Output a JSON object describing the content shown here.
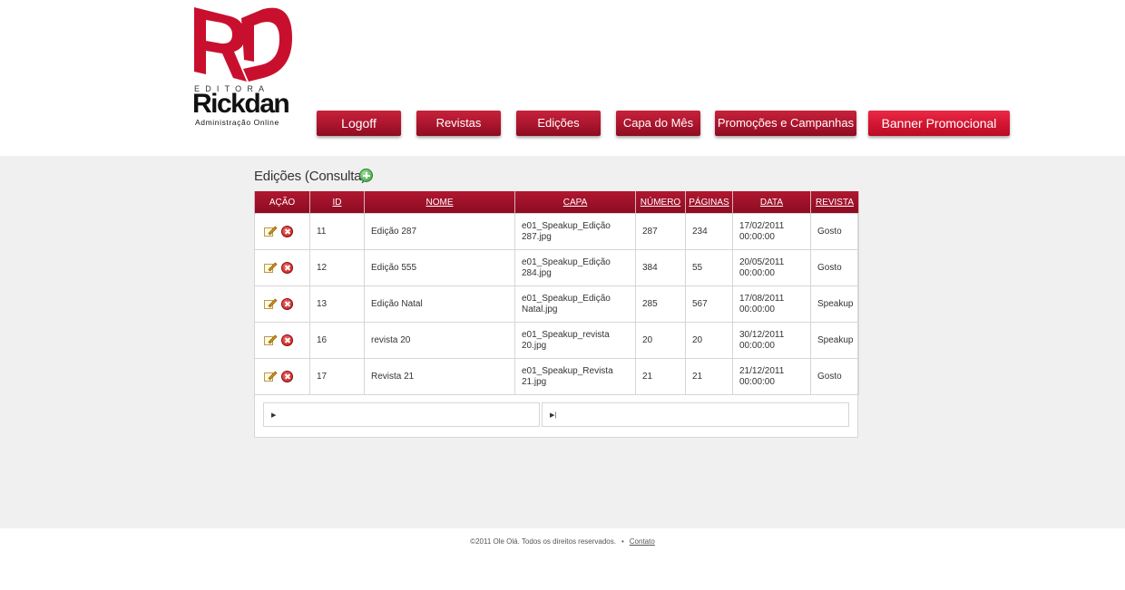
{
  "brand": {
    "editora": "EDITORA",
    "name": "Rickdan",
    "tagline": "Administração Online"
  },
  "nav": {
    "logoff": "Logoff",
    "revistas": "Revistas",
    "edicoes": "Edições",
    "capa_do_mes": "Capa do Mês",
    "promocoes": "Promoções e Campanhas",
    "banner": "Banner Promocional"
  },
  "page": {
    "title": "Edições (Consulta)"
  },
  "table": {
    "headers": {
      "acao": "AÇÃO",
      "id": "ID",
      "nome": "NOME",
      "capa": "CAPA",
      "numero": "NÚMERO",
      "paginas": "PÁGINAS",
      "data": "DATA",
      "revista": "REVISTA"
    },
    "rows": [
      {
        "id": "11",
        "nome": "Edição 287",
        "capa": "e01_Speakup_Edição 287.jpg",
        "numero": "287",
        "paginas": "234",
        "data": "17/02/2011 00:00:00",
        "revista": "Gosto"
      },
      {
        "id": "12",
        "nome": "Edição 555",
        "capa": "e01_Speakup_Edição 284.jpg",
        "numero": "384",
        "paginas": "55",
        "data": "20/05/2011 00:00:00",
        "revista": "Gosto"
      },
      {
        "id": "13",
        "nome": "Edição Natal",
        "capa": "e01_Speakup_Edição Natal.jpg",
        "numero": "285",
        "paginas": "567",
        "data": "17/08/2011 00:00:00",
        "revista": "Speakup"
      },
      {
        "id": "16",
        "nome": "revista 20",
        "capa": "e01_Speakup_revista 20.jpg",
        "numero": "20",
        "paginas": "20",
        "data": "30/12/2011 00:00:00",
        "revista": "Speakup"
      },
      {
        "id": "17",
        "nome": "Revista 21",
        "capa": "e01_Speakup_Revista 21.jpg",
        "numero": "21",
        "paginas": "21",
        "data": "21/12/2011 00:00:00",
        "revista": "Gosto"
      }
    ]
  },
  "pager": {
    "next_glyph": "▶",
    "last_glyph": "▶|"
  },
  "footer": {
    "copyright": "©2011 Ole Olá. Todos os direitos reservados.",
    "separator": "•",
    "contato": "Contato"
  },
  "colors": {
    "brand_red": "#c8102e",
    "header_red": "#a0122b",
    "content_bg": "#f0f0f0"
  }
}
